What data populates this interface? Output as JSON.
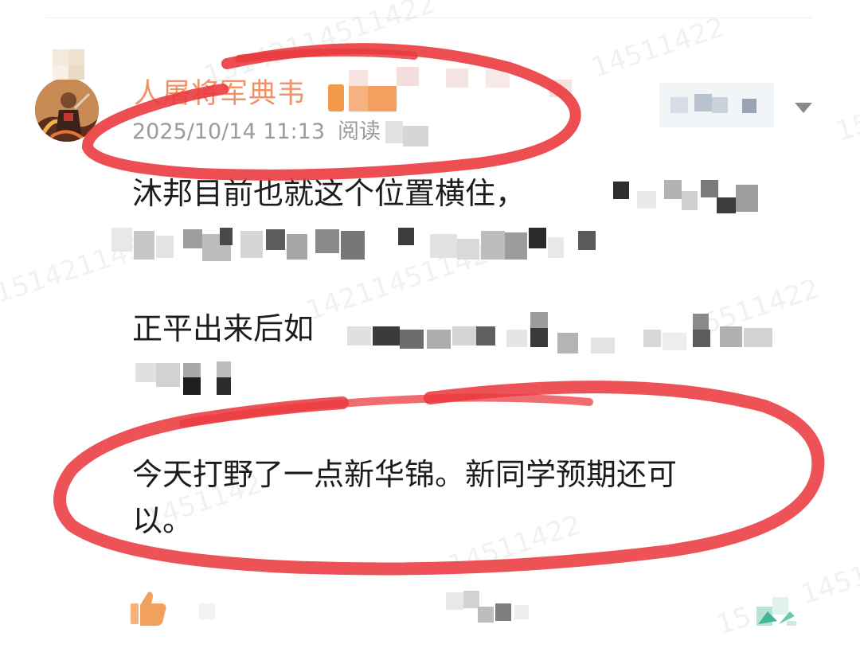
{
  "post": {
    "username": "人屠将军典韦",
    "timestamp": "2025/10/14 11:13",
    "read_label": "阅读",
    "paragraph_1": "沐邦目前也就这个位置横住，",
    "paragraph_2": "正平出来后如",
    "paragraph_3_line_1": "今天打野了一点新华锦。新同学预期还可",
    "paragraph_3_line_2": "以。"
  },
  "watermark": {
    "text_1": "15142114511422",
    "text_2": "14511422",
    "text_3": "151421145",
    "text_4": "14211451142",
    "text_5": "5511422",
    "text_6": "1451142",
    "text_7": "14511422",
    "text_8": "1451",
    "text_9": "15",
    "text_10": "15"
  },
  "colors": {
    "username": "#f29268",
    "meta_text": "#9b9b9b",
    "body_text": "#1c1c1c",
    "annotation_red": "#ea3b3f",
    "like_icon": "#f2a05e",
    "share_icon": "#43b59a"
  },
  "icons": {
    "avatar": "warrior-avatar",
    "dropdown": "chevron-down-icon",
    "like": "thumbs-up-icon",
    "share": "share-icon"
  }
}
